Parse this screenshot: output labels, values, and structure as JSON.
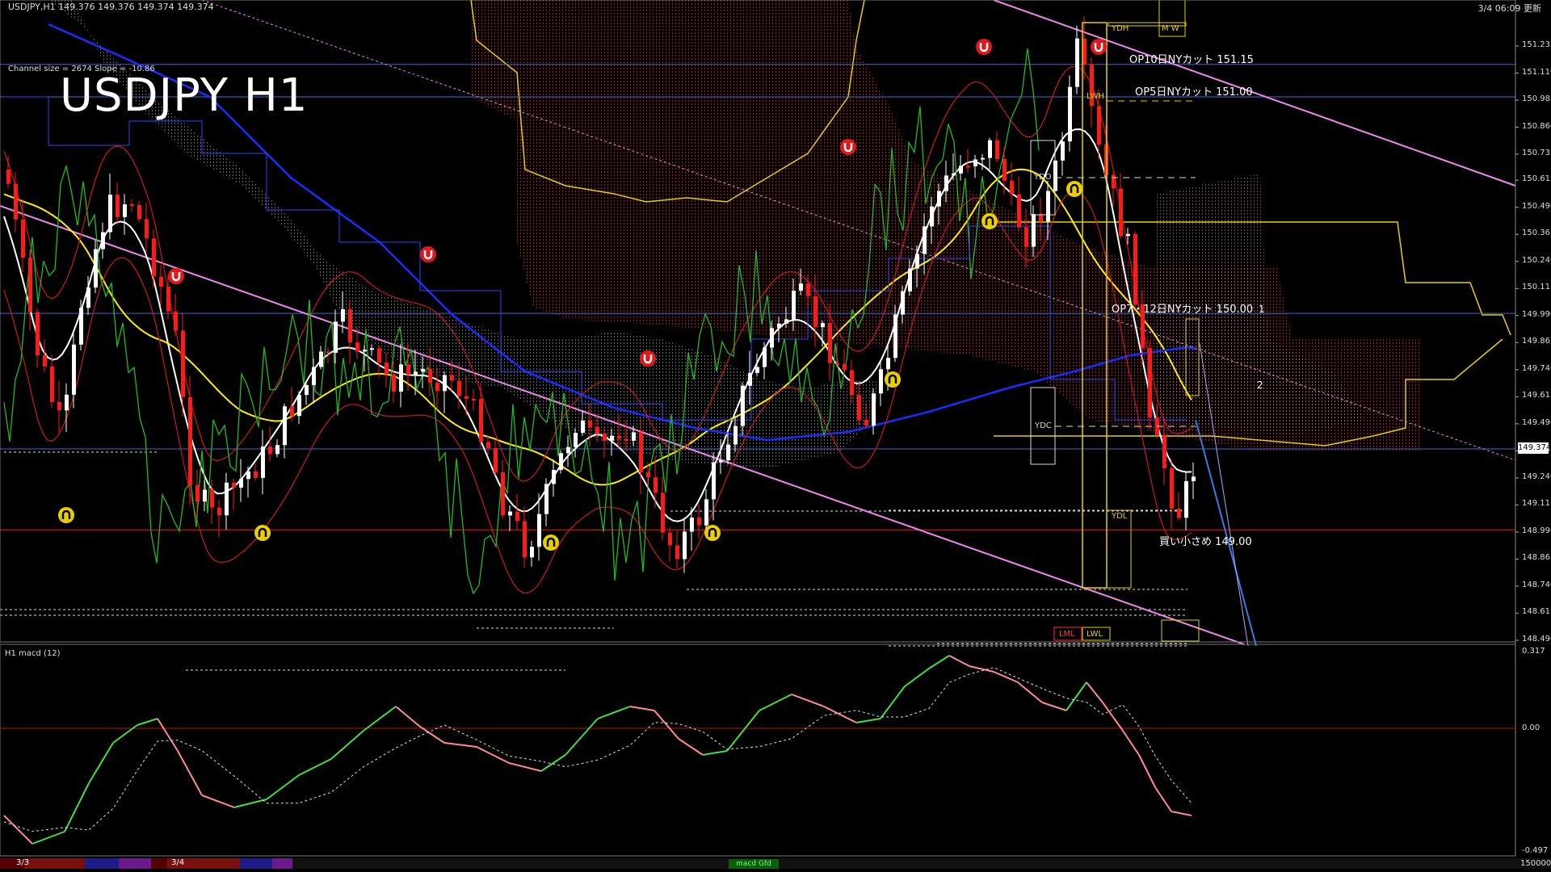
{
  "header": {
    "symbol_line": "USDJPY,H1  149.376 149.376 149.374 149.374",
    "channel_text": "Channel size = 2674 Slope = -10.86",
    "title": "USDJPY H1",
    "clock": "3/4 06:09 更新"
  },
  "levels": {
    "op10": "OP10日NYカット 151.15",
    "op5": "OP5日NYカット 151.00",
    "op7": "OP7・12日NYカット 150.00",
    "buy": "買い小さめ 149.00"
  },
  "box_labels": {
    "ydh": "YDH",
    "ydo": "YDO",
    "ydc": "YDC",
    "ydl": "YDL",
    "lwh": "LWH",
    "lwl": "LWL",
    "lml": "LML",
    "mw": "M  W"
  },
  "markers": {
    "one": "1",
    "two": "2"
  },
  "price_axis": [
    "151.235",
    "151.110",
    "150.985",
    "150.860",
    "150.735",
    "150.615",
    "150.490",
    "150.365",
    "150.240",
    "150.115",
    "149.990",
    "149.865",
    "149.740",
    "149.615",
    "149.490",
    "149.365",
    "149.240",
    "149.115",
    "148.990",
    "148.865",
    "148.740",
    "148.615",
    "148.490"
  ],
  "current_price": "149.374",
  "macd": {
    "header": "H1  macd (12)",
    "top": "0.317",
    "zero": "0.00",
    "bottom": "-0.497"
  },
  "period_bar": {
    "labels": [
      "3/3",
      "3/4"
    ],
    "green_label": "macd Gfd",
    "right_value": "150000"
  },
  "colors": {
    "background": "#000000",
    "bull": "#ffffff",
    "bear": "#ff1a1a",
    "ma_white": "#ffffff",
    "ma_yellow": "#ffee00",
    "ma_blue": "#1a2cff",
    "trend_pink": "#ee88ee",
    "level_blue": "#3a6bd6",
    "level_red": "#cc1111",
    "macd_green": "#44dd44",
    "macd_pink": "#ff8899",
    "cloud_red": "#bb2020",
    "cloud_white": "#dddddd",
    "box_yellow": "#e8d000"
  },
  "icons": [
    "arrow-up-fractal-icon",
    "arrow-down-fractal-icon"
  ]
}
